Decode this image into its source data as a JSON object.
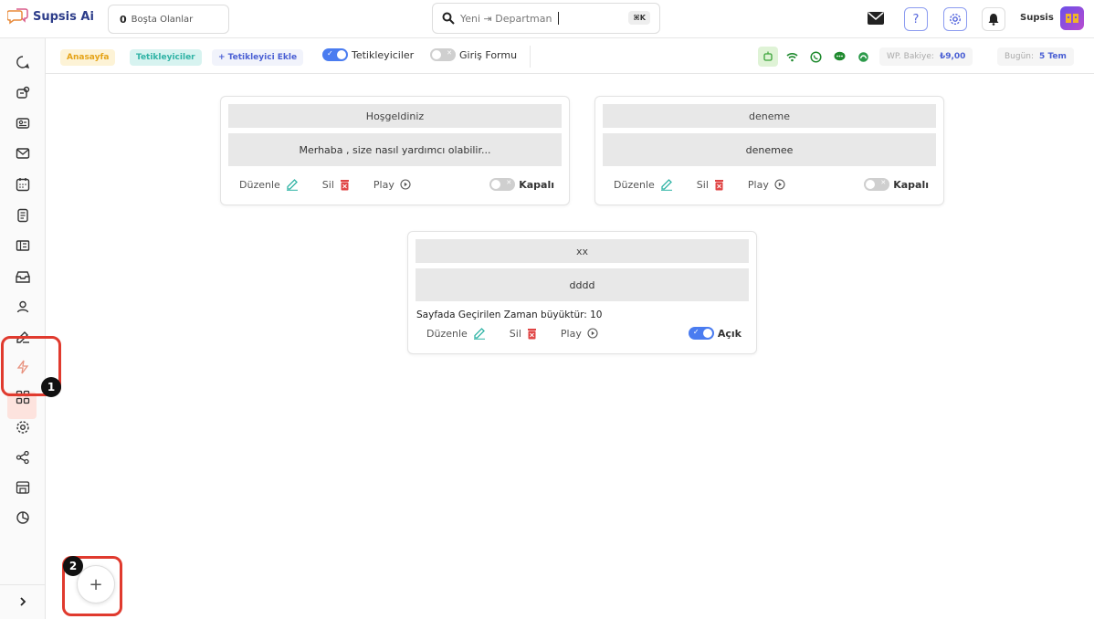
{
  "app": {
    "name": "Supsis Ai"
  },
  "header": {
    "idle_count": "0",
    "idle_label": "Boşta Olanlar",
    "search_text": "Yeni ⇥ Departman",
    "search_shortcut": "⌘K",
    "username": "Supsis"
  },
  "breadcrumb": {
    "home": "Anasayfa",
    "current": "Tetikleyiciler",
    "add": "+ Tetikleyici Ekle"
  },
  "toolbar": {
    "triggers_toggle_label": "Tetikleyiciler",
    "triggers_toggle_on": true,
    "entry_form_label": "Giriş Formu",
    "entry_form_on": false,
    "wp_balance_label": "WP. Bakiye:",
    "wp_balance_value": "₺9,00",
    "today_label": "Bugün:",
    "today_value": "5 Tem"
  },
  "triggers": [
    {
      "title": "Hoşgeldiniz",
      "message": "Merhaba , size nasıl yardımcı olabilir...",
      "condition": "",
      "edit_label": "Düzenle",
      "delete_label": "Sil",
      "play_label": "Play",
      "state_label": "Kapalı",
      "enabled": false
    },
    {
      "title": "deneme",
      "message": "denemee",
      "condition": "",
      "edit_label": "Düzenle",
      "delete_label": "Sil",
      "play_label": "Play",
      "state_label": "Kapalı",
      "enabled": false
    },
    {
      "title": "xx",
      "message": "dddd",
      "condition": "Sayfada Geçirilen Zaman büyüktür: 10",
      "edit_label": "Düzenle",
      "delete_label": "Sil",
      "play_label": "Play",
      "state_label": "Açık",
      "enabled": true
    }
  ],
  "annotations": {
    "step1": "1",
    "step2": "2"
  },
  "fab_label": "+",
  "colors": {
    "accent": "#4a7cf0",
    "highlight": "#e03a2e",
    "brand": "#2d3d8a"
  }
}
